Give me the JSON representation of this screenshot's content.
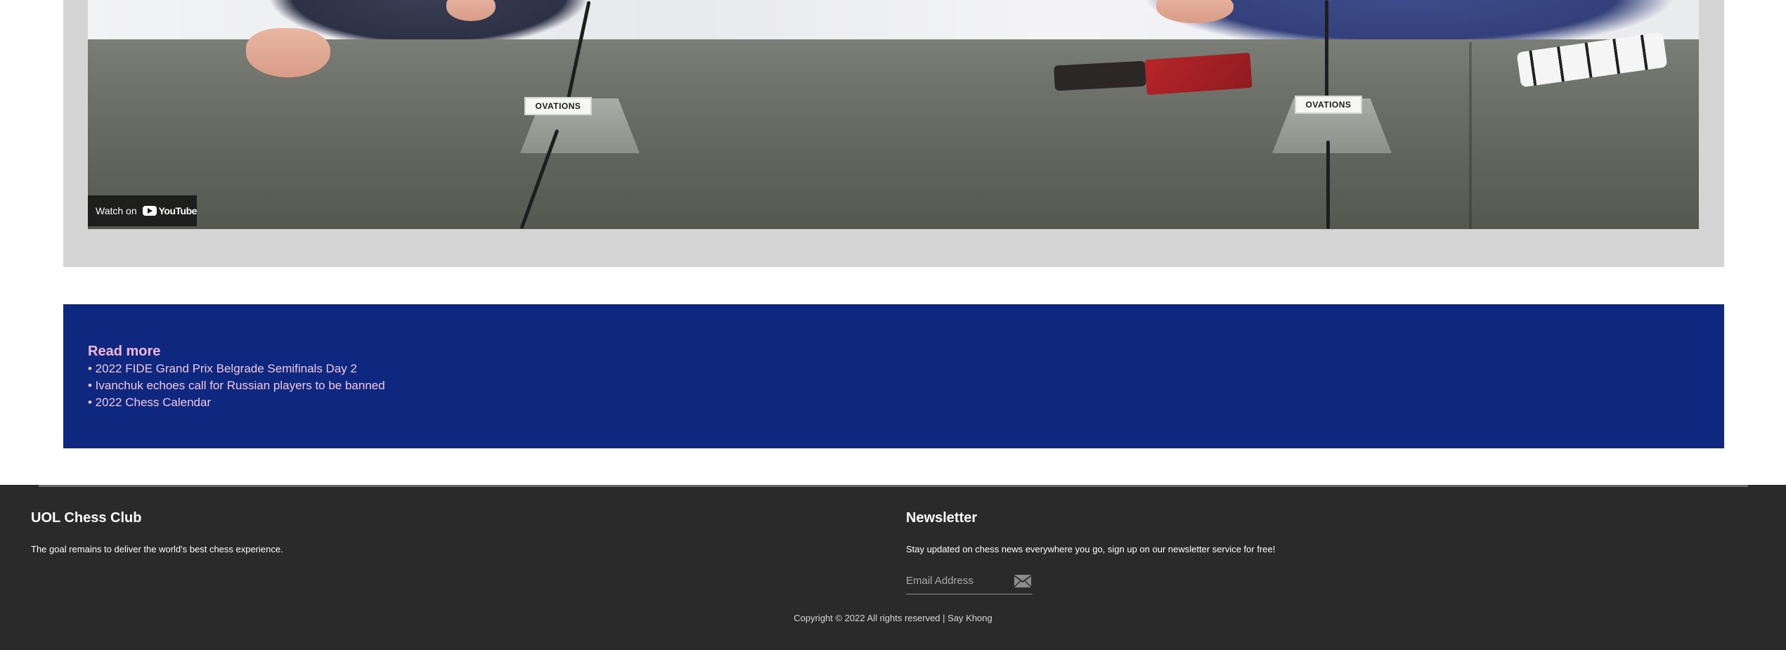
{
  "video": {
    "watch_on_label": "Watch on",
    "youtube_label": "YouTube",
    "mic_labels": [
      "OVATIONS",
      "OVATIONS"
    ]
  },
  "read_more": {
    "title": "Read more",
    "links": [
      "• 2022 FIDE Grand Prix Belgrade Semifinals Day 2",
      "• Ivanchuk echoes call for Russian players to be banned",
      "• 2022 Chess Calendar"
    ]
  },
  "footer": {
    "club_title": "UOL Chess Club",
    "club_tagline": "The goal remains to deliver the world's best chess experience.",
    "newsletter_title": "Newsletter",
    "newsletter_desc": "Stay updated on chess news everywhere you go, sign up on our newsletter service for free!",
    "email_placeholder": "Email Address",
    "send_icon": "envelope-icon",
    "copyright": "Copyright © 2022 All rights reserved | Say Khong"
  },
  "colors": {
    "video_bg": "#d4d4d4",
    "readmore_bg": "#0e287f",
    "readmore_text": "#f3c7e4",
    "footer_bg": "#2a2a2a"
  }
}
